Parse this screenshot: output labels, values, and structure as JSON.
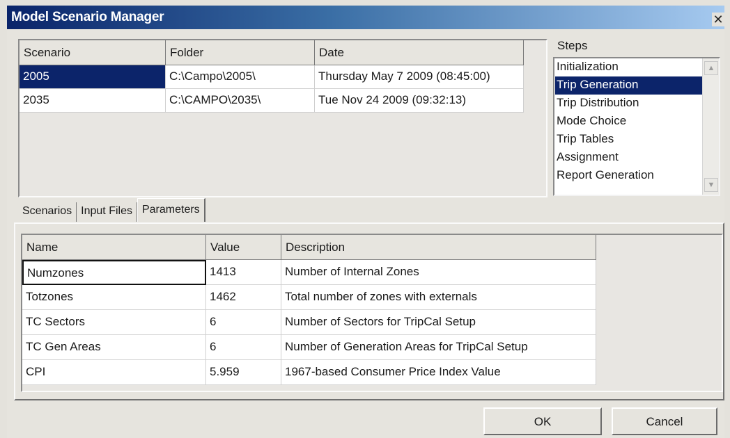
{
  "window": {
    "title": "Model Scenario Manager",
    "close_glyph": "✕"
  },
  "scenarios": {
    "columns": [
      "Scenario",
      "Folder",
      "Date"
    ],
    "rows": [
      {
        "scenario": "2005",
        "folder": "C:\\Campo\\2005\\",
        "date": "Thursday May 7 2009 (08:45:00)",
        "selected": true
      },
      {
        "scenario": "2035",
        "folder": "C:\\CAMPO\\2035\\",
        "date": "Tue Nov 24 2009 (09:32:13)",
        "selected": false
      }
    ]
  },
  "steps": {
    "label": "Steps",
    "items": [
      "Initialization",
      "Trip Generation",
      "Trip Distribution",
      "Mode Choice",
      "Trip Tables",
      "Assignment",
      "Report Generation"
    ],
    "selected_index": 1
  },
  "tabs": {
    "items": [
      "Scenarios",
      "Input Files",
      "Parameters"
    ],
    "active_index": 2
  },
  "parameters": {
    "columns": [
      "Name",
      "Value",
      "Description"
    ],
    "rows": [
      {
        "name": "Numzones",
        "value": "1413",
        "description": "Number of Internal Zones"
      },
      {
        "name": "Totzones",
        "value": "1462",
        "description": "Total number of zones with externals"
      },
      {
        "name": "TC Sectors",
        "value": "6",
        "description": "Number of Sectors for TripCal Setup"
      },
      {
        "name": "TC Gen Areas",
        "value": "6",
        "description": "Number of Generation Areas for TripCal Setup"
      },
      {
        "name": "CPI",
        "value": "5.959",
        "description": "1967-based Consumer Price Index Value"
      }
    ]
  },
  "buttons": {
    "ok": "OK",
    "cancel": "Cancel"
  },
  "colors": {
    "selection": "#0c246a",
    "title_start": "#0a246a",
    "title_end": "#a6caf0",
    "dialog_bg": "#e6e4de"
  }
}
